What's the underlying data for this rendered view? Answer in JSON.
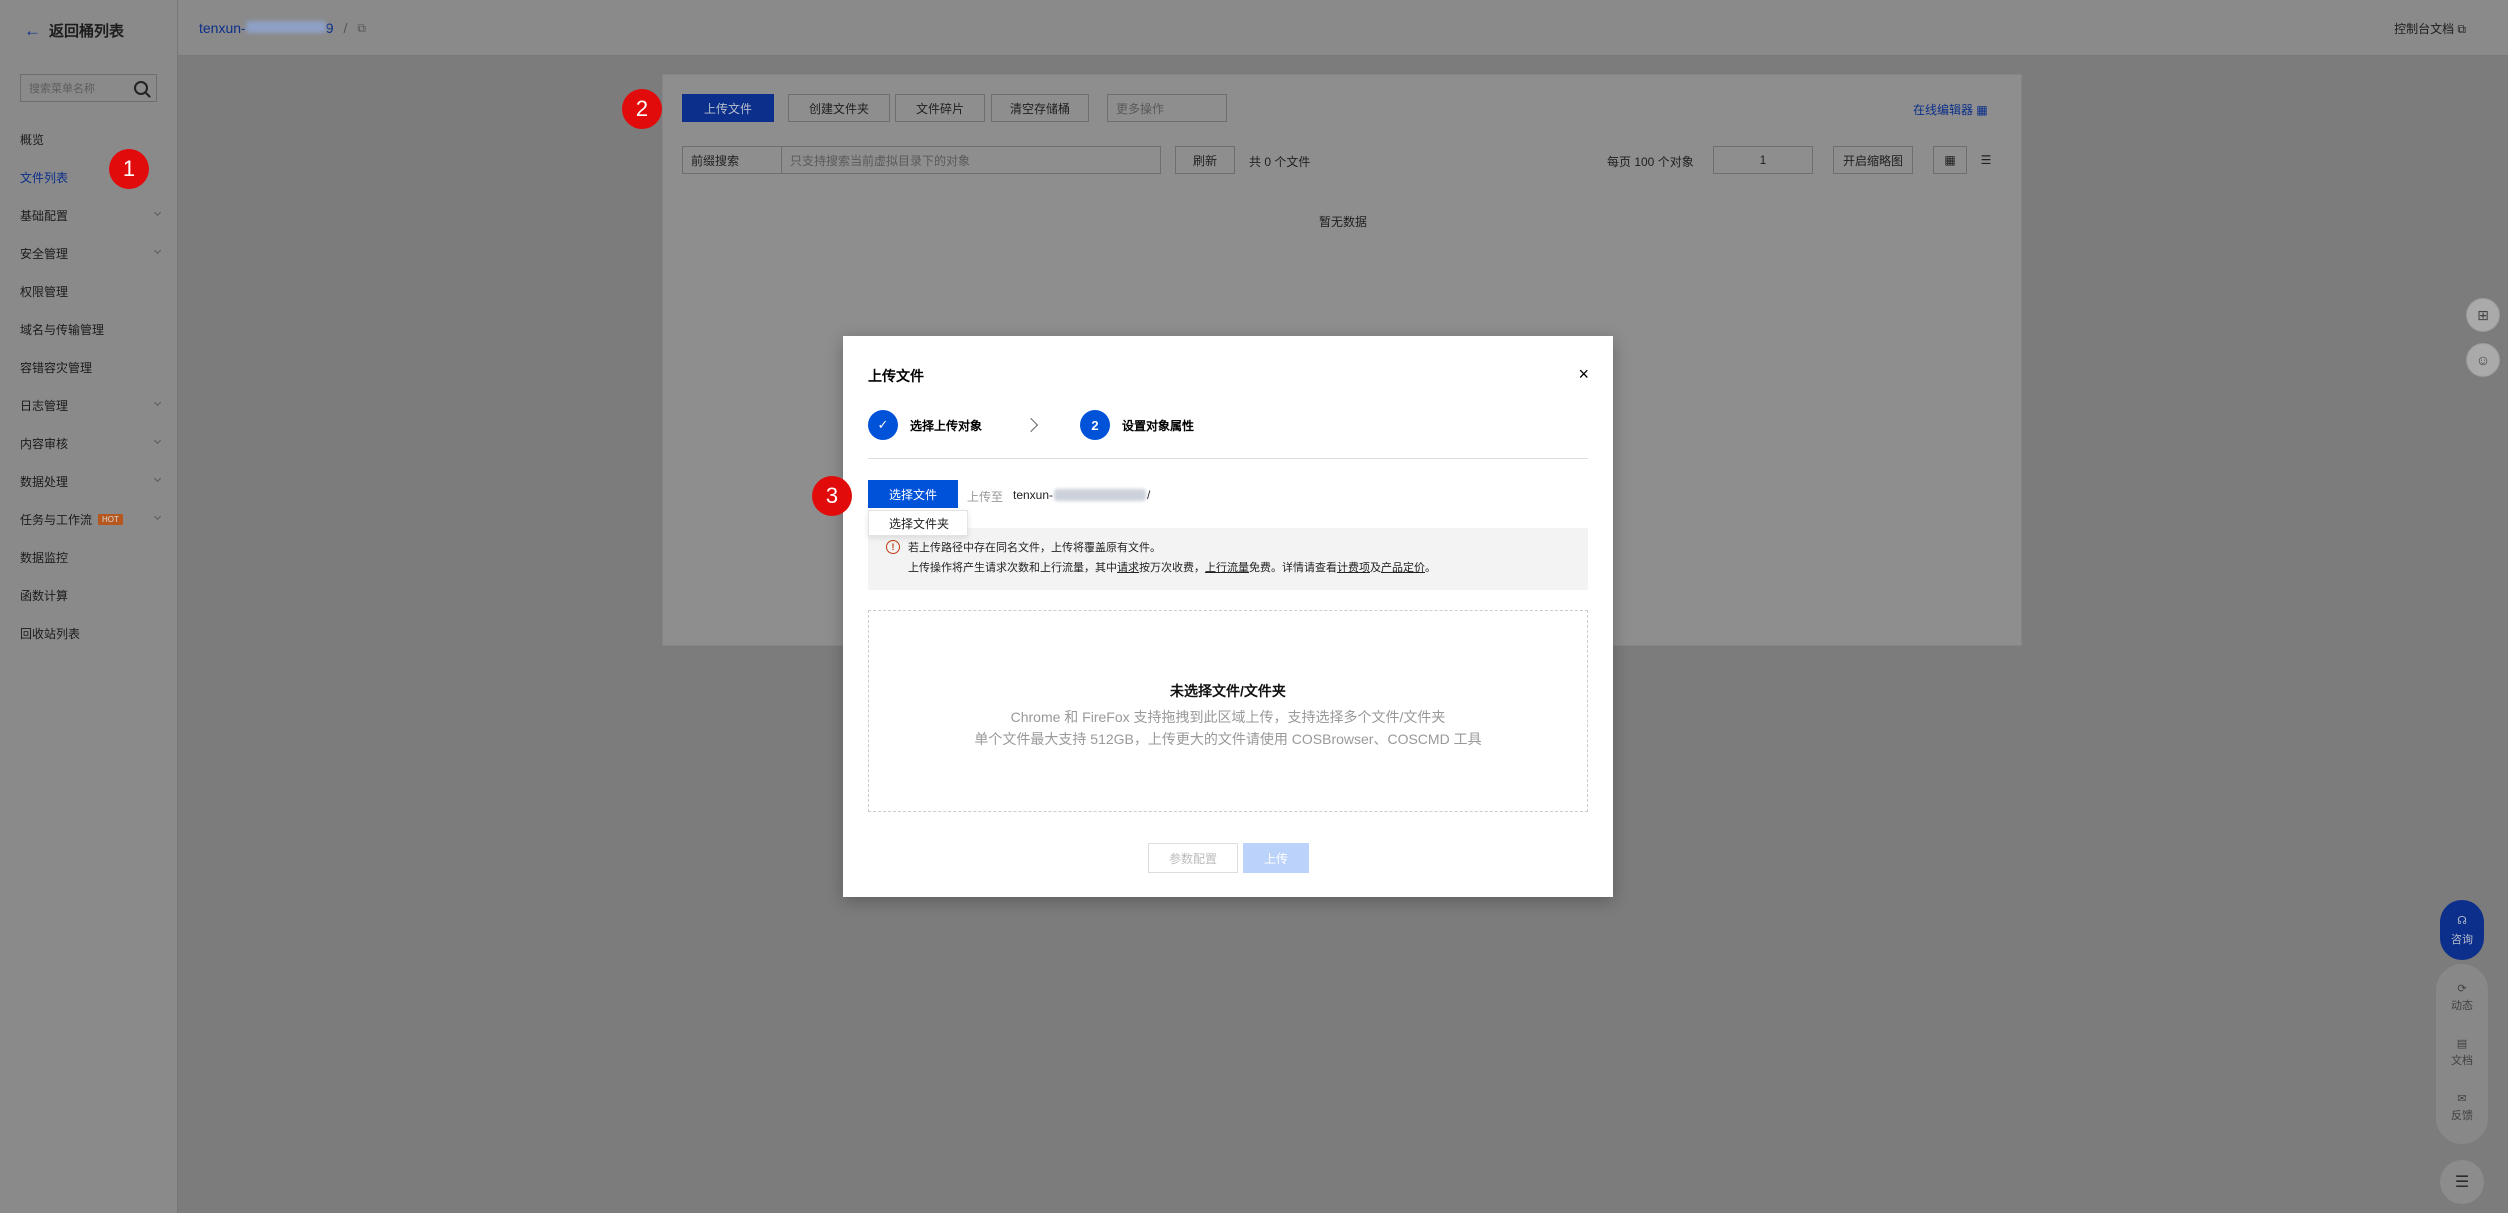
{
  "sidebar": {
    "back_label": "返回桶列表",
    "search_placeholder": "搜索菜单名称",
    "items": [
      {
        "label": "概览",
        "has_chevron": false
      },
      {
        "label": "文件列表",
        "has_chevron": false,
        "active": true
      },
      {
        "label": "基础配置",
        "has_chevron": true
      },
      {
        "label": "安全管理",
        "has_chevron": true
      },
      {
        "label": "权限管理",
        "has_chevron": false
      },
      {
        "label": "域名与传输管理",
        "has_chevron": false
      },
      {
        "label": "容错容灾管理",
        "has_chevron": false
      },
      {
        "label": "日志管理",
        "has_chevron": true
      },
      {
        "label": "内容审核",
        "has_chevron": true
      },
      {
        "label": "数据处理",
        "has_chevron": true
      },
      {
        "label": "任务与工作流",
        "has_chevron": true,
        "badge": "HOT"
      },
      {
        "label": "数据监控",
        "has_chevron": false
      },
      {
        "label": "函数计算",
        "has_chevron": false
      },
      {
        "label": "回收站列表",
        "has_chevron": false
      }
    ]
  },
  "header": {
    "bucket_prefix": "tenxun-",
    "bucket_suffix": "9",
    "crumb_sep": "/",
    "console_doc": "控制台文档 ⧉"
  },
  "toolbar": {
    "upload": "上传文件",
    "create_folder": "创建文件夹",
    "fragments": "文件碎片",
    "clear_bucket": "清空存储桶",
    "more_actions": "更多操作",
    "online_editor": "在线编辑器",
    "prefix_search": "前缀搜索",
    "search_placeholder": "只支持搜索当前虚拟目录下的对象",
    "refresh": "刷新",
    "total": "共 0 个文件",
    "per_page": "每页 100 个对象",
    "page": "1",
    "thumbnail": "开启缩略图",
    "empty": "暂无数据"
  },
  "callouts": [
    "1",
    "2",
    "3"
  ],
  "right_float": {
    "consult": "咨询",
    "news": "动态",
    "docs": "文档",
    "feedback": "反馈"
  },
  "modal": {
    "title": "上传文件",
    "close": "×",
    "step1_label": "选择上传对象",
    "step2_number": "2",
    "step2_label": "设置对象属性",
    "choose_file": "选择文件",
    "choose_folder": "选择文件夹",
    "upload_to": "上传至",
    "path_prefix": "tenxun-",
    "path_suffix": "/",
    "notice_line1": "若上传路径中存在同名文件，上传将覆盖原有文件。",
    "notice_a": "上传操作将产生请求次数和上行流量，其中",
    "notice_link1": "请求",
    "notice_b": "按万次收费，",
    "notice_link2": "上行流量",
    "notice_c": "免费。详情请查看",
    "notice_link3": "计费项",
    "notice_d": "及",
    "notice_link4": "产品定价",
    "notice_e": "。",
    "dz_title": "未选择文件/文件夹",
    "dz_line1": "Chrome 和 FireFox 支持拖拽到此区域上传，支持选择多个文件/文件夹",
    "dz_line2": "单个文件最大支持 512GB，上传更大的文件请使用 COSBrowser、COSCMD 工具",
    "param_config": "参数配置",
    "upload": "上传"
  },
  "colors": {
    "primary": "#0052d9",
    "callout": "#e10b0b",
    "overlay_bg": "#7f7f7f"
  }
}
